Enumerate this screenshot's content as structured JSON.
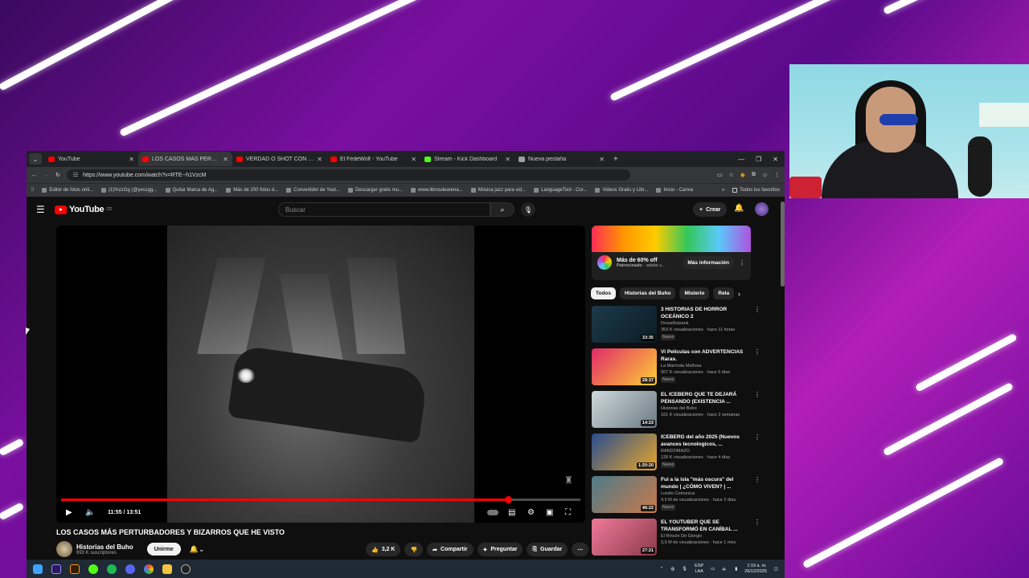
{
  "browser": {
    "tabs": [
      {
        "label": "YouTube",
        "fav": "#ff0000",
        "active": false
      },
      {
        "label": "LOS CASOS MÁS PERTURB",
        "fav": "#ff0000",
        "active": true
      },
      {
        "label": "VERDAD O SHOT CON PADRES",
        "fav": "#ff0000",
        "active": false
      },
      {
        "label": "El FedeWolf - YouTube",
        "fav": "#ff0000",
        "active": false
      },
      {
        "label": "Stream - Kick Dashboard",
        "fav": "#53fc18",
        "active": false
      },
      {
        "label": "Nueva pestaña",
        "fav": "#9aa0a6",
        "active": false
      }
    ],
    "url": "https://www.youtube.com/watch?v=RTE--h1VzcM",
    "bookmarks": [
      "Editor de fotos onli...",
      "(1)%zzGg (@yeszgg...",
      "Quitar Marca de Ag...",
      "Más de 200 fotos d...",
      "Convertidor de Yout...",
      "Descargar gratis mu...",
      "www.librosdearena...",
      "Música jazz para vid...",
      "LanguageTool - Cor...",
      "Videos Gratis y Libr...",
      "Inicio - Canva"
    ],
    "bookmarks_more": "Todos los favoritos"
  },
  "youtube": {
    "logo": "YouTube",
    "logo_country": "CO",
    "search_placeholder": "Buscar",
    "create_label": "Crear",
    "player": {
      "time": "11:55 / 13:51",
      "progress": 0.86
    },
    "video_title": "LOS CASOS MÁS PERTURBADORES Y BIZARROS QUE HE VISTO",
    "channel_name": "Historias del Buho",
    "channel_subs": "693 K suscriptores",
    "join_label": "Unirme",
    "likes": "3,2 K",
    "share_label": "Compartir",
    "ask_label": "Preguntar",
    "save_label": "Guardar",
    "ad": {
      "title": "Más de 60% off",
      "sponsored": "Patrocinado",
      "domain": "adobe.c...",
      "button": "Más información"
    },
    "chips": [
      "Todos",
      "Historias del Buho",
      "Misterio",
      "Rela"
    ],
    "recommendations": [
      {
        "title": "3 HISTORIAS DE HORROR OCEÁNICO 2",
        "channel": "DrossRotzank",
        "views": "353 K visualizaciones · hace 11 horas",
        "duration": "33:35",
        "new": true,
        "thumb": "linear-gradient(135deg,#1d3a4a,#0b1c24)"
      },
      {
        "title": "Vi Películas con ADVERTENCIAS Raras.",
        "channel": "La Marmota Mañosa",
        "views": "507 K visualizaciones · hace 6 días",
        "duration": "28:37",
        "new": true,
        "thumb": "linear-gradient(135deg,#e02a6a,#ffcf33)"
      },
      {
        "title": "EL ICEBERG QUE TE DEJARÁ PENSANDO (EXISTENCIA ...",
        "channel": "Historias del Buho",
        "views": "161 K visualizaciones · hace 2 semanas",
        "duration": "14:23",
        "new": false,
        "thumb": "linear-gradient(135deg,#cfd8dc,#6b7b83)"
      },
      {
        "title": "ICEBERG del año 2025 (Nuevos avances tecnologicos, ...",
        "channel": "RANDOMAZO",
        "views": "128 K visualizaciones · hace 4 días",
        "duration": "1:20:20",
        "new": true,
        "thumb": "linear-gradient(135deg,#2a4d8f,#e5a52b)"
      },
      {
        "title": "Fui a la isla \"más oscura\" del mundo | ¿CÓMO VIVEN? | ...",
        "channel": "Luisito Comunica",
        "views": "4,5 M de visualizaciones · hace 2 días",
        "duration": "46:22",
        "new": true,
        "thumb": "linear-gradient(135deg,#4d7b8a,#c97a4a)"
      },
      {
        "title": "EL YOUTUBER QUE SE TRANSFORMÓ EN CANÍBAL ...",
        "channel": "El Rincón De Giorgio",
        "views": "3,5 M de visualizaciones · hace 1 mes",
        "duration": "27:21",
        "new": false,
        "thumb": "linear-gradient(135deg,#f07a9a,#8a3a4a)"
      }
    ],
    "new_label": "Nuevo"
  },
  "taskbar": {
    "lang": "ESP",
    "lang2": "LAA",
    "time": "1:19 a. m.",
    "date": "26/12/2025"
  }
}
